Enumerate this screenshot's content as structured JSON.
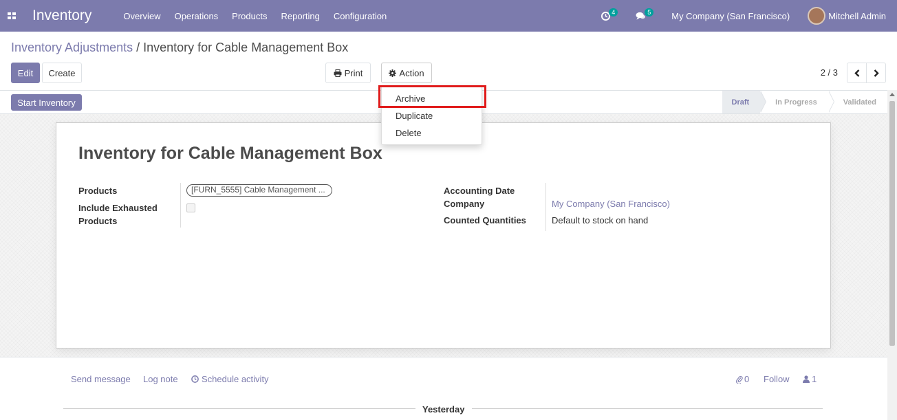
{
  "navbar": {
    "brand": "Inventory",
    "menu": [
      "Overview",
      "Operations",
      "Products",
      "Reporting",
      "Configuration"
    ],
    "activity_count": "4",
    "message_count": "5",
    "company": "My Company (San Francisco)",
    "user": "Mitchell Admin"
  },
  "breadcrumb": {
    "parent": "Inventory Adjustments",
    "separator": " / ",
    "current": "Inventory for Cable Management Box"
  },
  "toolbar": {
    "edit_label": "Edit",
    "create_label": "Create",
    "print_label": "Print",
    "action_label": "Action",
    "pager": "2 / 3"
  },
  "action_menu": {
    "items": [
      "Archive",
      "Duplicate",
      "Delete"
    ]
  },
  "statusbar": {
    "start_label": "Start Inventory",
    "stages": [
      "Draft",
      "In Progress",
      "Validated"
    ],
    "active_stage": "Draft"
  },
  "form": {
    "title": "Inventory for Cable Management Box",
    "products_label": "Products",
    "products_tag": "[FURN_5555] Cable Management ...",
    "include_exhausted_label_line1": "Include Exhausted",
    "include_exhausted_label_line2": "Products",
    "accounting_date_label": "Accounting Date",
    "company_label": "Company",
    "company_value": "My Company (San Francisco)",
    "counted_label": "Counted Quantities",
    "counted_value": "Default to stock on hand"
  },
  "chatter": {
    "send_message": "Send message",
    "log_note": "Log note",
    "schedule_activity": "Schedule activity",
    "attachments_count": "0",
    "follow_label": "Follow",
    "followers_count": "1",
    "day_label": "Yesterday"
  },
  "colors": {
    "brand": "#7c7bad",
    "badge": "#00a09d",
    "highlight": "#e01b1b"
  }
}
